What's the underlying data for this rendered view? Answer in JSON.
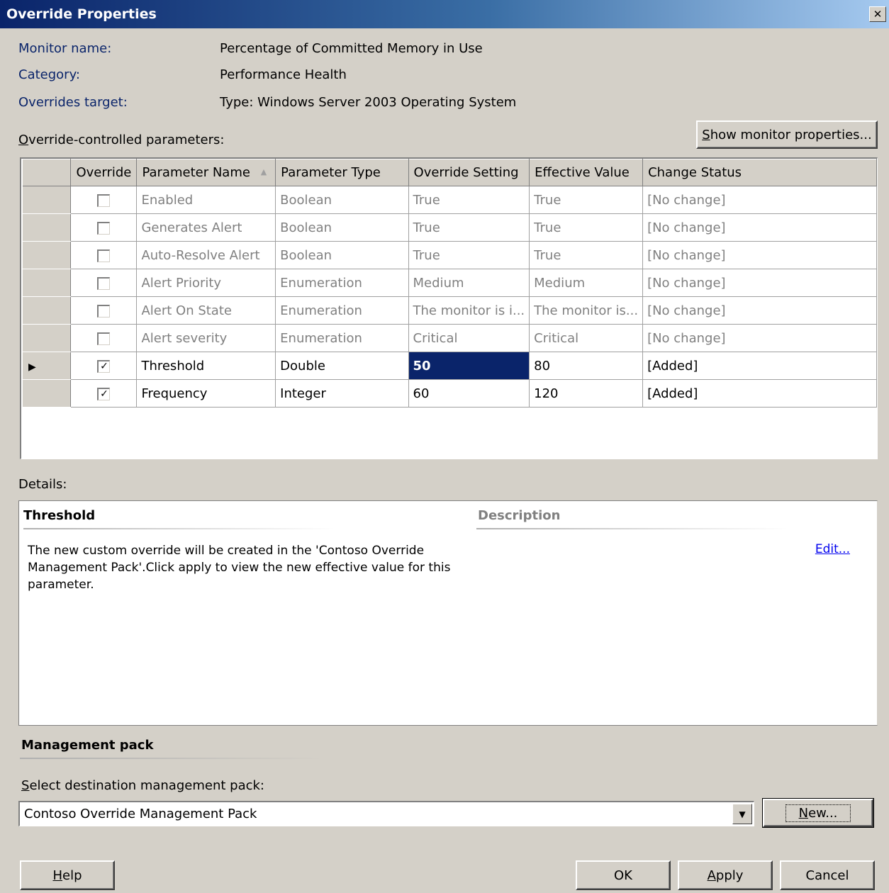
{
  "window": {
    "title": "Override Properties",
    "close_glyph": "✕"
  },
  "info": {
    "monitor_name_label": "Monitor name:",
    "monitor_name_value": "Percentage of Committed Memory in Use",
    "category_label": "Category:",
    "category_value": "Performance Health",
    "overrides_target_label": "Overrides target:",
    "overrides_target_value": "Type: Windows Server 2003 Operating System"
  },
  "params_label": {
    "accel": "O",
    "rest": "verride-controlled parameters:"
  },
  "show_monitor_button": {
    "accel": "S",
    "rest": "how monitor properties..."
  },
  "grid": {
    "columns": [
      "Override",
      "Parameter Name",
      "Parameter Type",
      "Override Setting",
      "Effective Value",
      "Change Status"
    ],
    "sort_glyph": "▲",
    "rows": [
      {
        "override": false,
        "name": "Enabled",
        "type": "Boolean",
        "setting": "True",
        "effective": "True",
        "status": "[No change]"
      },
      {
        "override": false,
        "name": "Generates Alert",
        "type": "Boolean",
        "setting": "True",
        "effective": "True",
        "status": "[No change]"
      },
      {
        "override": false,
        "name": "Auto-Resolve Alert",
        "type": "Boolean",
        "setting": "True",
        "effective": "True",
        "status": "[No change]"
      },
      {
        "override": false,
        "name": "Alert Priority",
        "type": "Enumeration",
        "setting": "Medium",
        "effective": "Medium",
        "status": "[No change]"
      },
      {
        "override": false,
        "name": "Alert On State",
        "type": "Enumeration",
        "setting": "The monitor is i...",
        "effective": "The monitor is...",
        "status": "[No change]"
      },
      {
        "override": false,
        "name": "Alert severity",
        "type": "Enumeration",
        "setting": "Critical",
        "effective": "Critical",
        "status": "[No change]"
      },
      {
        "override": true,
        "current": true,
        "name": "Threshold",
        "type": "Double",
        "setting": "50",
        "effective": "80",
        "status": "[Added]"
      },
      {
        "override": true,
        "name": "Frequency",
        "type": "Integer",
        "setting": "60",
        "effective": "120",
        "status": "[Added]"
      }
    ]
  },
  "details_label": "Details:",
  "details": {
    "title": "Threshold",
    "description_heading": "Description",
    "text": "The new custom override will be created in the 'Contoso Override Management Pack'.Click apply to view  the new effective value for this parameter.",
    "edit_link": "Edit..."
  },
  "management_pack": {
    "heading": "Management pack",
    "select_label": {
      "accel": "S",
      "rest": "elect destination management pack:"
    },
    "selected": "Contoso Override Management Pack",
    "new_button": {
      "accel": "N",
      "rest": "ew..."
    }
  },
  "buttons": {
    "help": {
      "accel": "H",
      "rest": "elp"
    },
    "ok": "OK",
    "apply": {
      "accel": "A",
      "rest": "pply"
    },
    "cancel": "Cancel"
  }
}
